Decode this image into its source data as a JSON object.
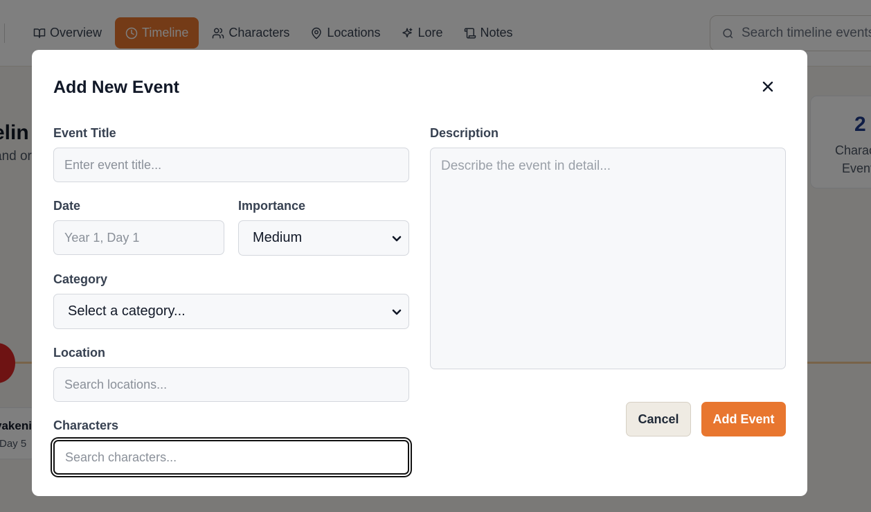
{
  "nav": {
    "items": [
      {
        "label": "Overview",
        "icon": "book-open-icon"
      },
      {
        "label": "Timeline",
        "icon": "clock-icon",
        "active": true
      },
      {
        "label": "Characters",
        "icon": "users-icon"
      },
      {
        "label": "Locations",
        "icon": "map-pin-icon"
      },
      {
        "label": "Lore",
        "icon": "sparkles-icon"
      },
      {
        "label": "Notes",
        "icon": "scroll-icon"
      }
    ],
    "search_placeholder": "Search timeline events"
  },
  "background": {
    "title_fragment": "elin",
    "subtitle_fragment": "and or",
    "stat": {
      "value": "2",
      "label_line1": "Charac",
      "label_line2": "Event"
    },
    "event_card": {
      "title": "vakeni",
      "date": "Day 5"
    }
  },
  "modal": {
    "title": "Add New Event",
    "close_icon": "close-icon",
    "fields": {
      "title": {
        "label": "Event Title",
        "placeholder": "Enter event title..."
      },
      "date": {
        "label": "Date",
        "placeholder": "Year 1, Day 1"
      },
      "importance": {
        "label": "Importance",
        "value": "Medium"
      },
      "category": {
        "label": "Category",
        "value": "Select a category..."
      },
      "location": {
        "label": "Location",
        "placeholder": "Search locations..."
      },
      "characters": {
        "label": "Characters",
        "placeholder": "Search characters..."
      },
      "description": {
        "label": "Description",
        "placeholder": "Describe the event in detail..."
      }
    },
    "buttons": {
      "cancel": "Cancel",
      "add": "Add Event"
    }
  },
  "colors": {
    "accent": "#e8762f",
    "overlay": "rgba(0,0,0,0.5)",
    "stat_number": "#1e3a8a"
  }
}
